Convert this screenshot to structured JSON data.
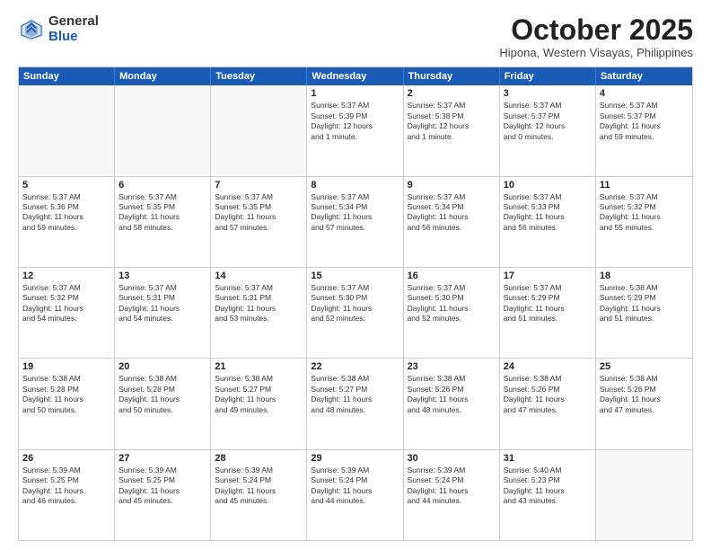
{
  "logo": {
    "general": "General",
    "blue": "Blue"
  },
  "title": "October 2025",
  "location": "Hipona, Western Visayas, Philippines",
  "days": [
    "Sunday",
    "Monday",
    "Tuesday",
    "Wednesday",
    "Thursday",
    "Friday",
    "Saturday"
  ],
  "weeks": [
    [
      {
        "num": "",
        "lines": []
      },
      {
        "num": "",
        "lines": []
      },
      {
        "num": "",
        "lines": []
      },
      {
        "num": "1",
        "lines": [
          "Sunrise: 5:37 AM",
          "Sunset: 5:39 PM",
          "Daylight: 12 hours",
          "and 1 minute."
        ]
      },
      {
        "num": "2",
        "lines": [
          "Sunrise: 5:37 AM",
          "Sunset: 5:38 PM",
          "Daylight: 12 hours",
          "and 1 minute."
        ]
      },
      {
        "num": "3",
        "lines": [
          "Sunrise: 5:37 AM",
          "Sunset: 5:37 PM",
          "Daylight: 12 hours",
          "and 0 minutes."
        ]
      },
      {
        "num": "4",
        "lines": [
          "Sunrise: 5:37 AM",
          "Sunset: 5:37 PM",
          "Daylight: 11 hours",
          "and 59 minutes."
        ]
      }
    ],
    [
      {
        "num": "5",
        "lines": [
          "Sunrise: 5:37 AM",
          "Sunset: 5:36 PM",
          "Daylight: 11 hours",
          "and 59 minutes."
        ]
      },
      {
        "num": "6",
        "lines": [
          "Sunrise: 5:37 AM",
          "Sunset: 5:35 PM",
          "Daylight: 11 hours",
          "and 58 minutes."
        ]
      },
      {
        "num": "7",
        "lines": [
          "Sunrise: 5:37 AM",
          "Sunset: 5:35 PM",
          "Daylight: 11 hours",
          "and 57 minutes."
        ]
      },
      {
        "num": "8",
        "lines": [
          "Sunrise: 5:37 AM",
          "Sunset: 5:34 PM",
          "Daylight: 11 hours",
          "and 57 minutes."
        ]
      },
      {
        "num": "9",
        "lines": [
          "Sunrise: 5:37 AM",
          "Sunset: 5:34 PM",
          "Daylight: 11 hours",
          "and 56 minutes."
        ]
      },
      {
        "num": "10",
        "lines": [
          "Sunrise: 5:37 AM",
          "Sunset: 5:33 PM",
          "Daylight: 11 hours",
          "and 56 minutes."
        ]
      },
      {
        "num": "11",
        "lines": [
          "Sunrise: 5:37 AM",
          "Sunset: 5:32 PM",
          "Daylight: 11 hours",
          "and 55 minutes."
        ]
      }
    ],
    [
      {
        "num": "12",
        "lines": [
          "Sunrise: 5:37 AM",
          "Sunset: 5:32 PM",
          "Daylight: 11 hours",
          "and 54 minutes."
        ]
      },
      {
        "num": "13",
        "lines": [
          "Sunrise: 5:37 AM",
          "Sunset: 5:31 PM",
          "Daylight: 11 hours",
          "and 54 minutes."
        ]
      },
      {
        "num": "14",
        "lines": [
          "Sunrise: 5:37 AM",
          "Sunset: 5:31 PM",
          "Daylight: 11 hours",
          "and 53 minutes."
        ]
      },
      {
        "num": "15",
        "lines": [
          "Sunrise: 5:37 AM",
          "Sunset: 5:30 PM",
          "Daylight: 11 hours",
          "and 52 minutes."
        ]
      },
      {
        "num": "16",
        "lines": [
          "Sunrise: 5:37 AM",
          "Sunset: 5:30 PM",
          "Daylight: 11 hours",
          "and 52 minutes."
        ]
      },
      {
        "num": "17",
        "lines": [
          "Sunrise: 5:37 AM",
          "Sunset: 5:29 PM",
          "Daylight: 11 hours",
          "and 51 minutes."
        ]
      },
      {
        "num": "18",
        "lines": [
          "Sunrise: 5:38 AM",
          "Sunset: 5:29 PM",
          "Daylight: 11 hours",
          "and 51 minutes."
        ]
      }
    ],
    [
      {
        "num": "19",
        "lines": [
          "Sunrise: 5:38 AM",
          "Sunset: 5:28 PM",
          "Daylight: 11 hours",
          "and 50 minutes."
        ]
      },
      {
        "num": "20",
        "lines": [
          "Sunrise: 5:38 AM",
          "Sunset: 5:28 PM",
          "Daylight: 11 hours",
          "and 50 minutes."
        ]
      },
      {
        "num": "21",
        "lines": [
          "Sunrise: 5:38 AM",
          "Sunset: 5:27 PM",
          "Daylight: 11 hours",
          "and 49 minutes."
        ]
      },
      {
        "num": "22",
        "lines": [
          "Sunrise: 5:38 AM",
          "Sunset: 5:27 PM",
          "Daylight: 11 hours",
          "and 48 minutes."
        ]
      },
      {
        "num": "23",
        "lines": [
          "Sunrise: 5:38 AM",
          "Sunset: 5:26 PM",
          "Daylight: 11 hours",
          "and 48 minutes."
        ]
      },
      {
        "num": "24",
        "lines": [
          "Sunrise: 5:38 AM",
          "Sunset: 5:26 PM",
          "Daylight: 11 hours",
          "and 47 minutes."
        ]
      },
      {
        "num": "25",
        "lines": [
          "Sunrise: 5:38 AM",
          "Sunset: 5:26 PM",
          "Daylight: 11 hours",
          "and 47 minutes."
        ]
      }
    ],
    [
      {
        "num": "26",
        "lines": [
          "Sunrise: 5:39 AM",
          "Sunset: 5:25 PM",
          "Daylight: 11 hours",
          "and 46 minutes."
        ]
      },
      {
        "num": "27",
        "lines": [
          "Sunrise: 5:39 AM",
          "Sunset: 5:25 PM",
          "Daylight: 11 hours",
          "and 45 minutes."
        ]
      },
      {
        "num": "28",
        "lines": [
          "Sunrise: 5:39 AM",
          "Sunset: 5:24 PM",
          "Daylight: 11 hours",
          "and 45 minutes."
        ]
      },
      {
        "num": "29",
        "lines": [
          "Sunrise: 5:39 AM",
          "Sunset: 5:24 PM",
          "Daylight: 11 hours",
          "and 44 minutes."
        ]
      },
      {
        "num": "30",
        "lines": [
          "Sunrise: 5:39 AM",
          "Sunset: 5:24 PM",
          "Daylight: 11 hours",
          "and 44 minutes."
        ]
      },
      {
        "num": "31",
        "lines": [
          "Sunrise: 5:40 AM",
          "Sunset: 5:23 PM",
          "Daylight: 11 hours",
          "and 43 minutes."
        ]
      },
      {
        "num": "",
        "lines": []
      }
    ]
  ]
}
